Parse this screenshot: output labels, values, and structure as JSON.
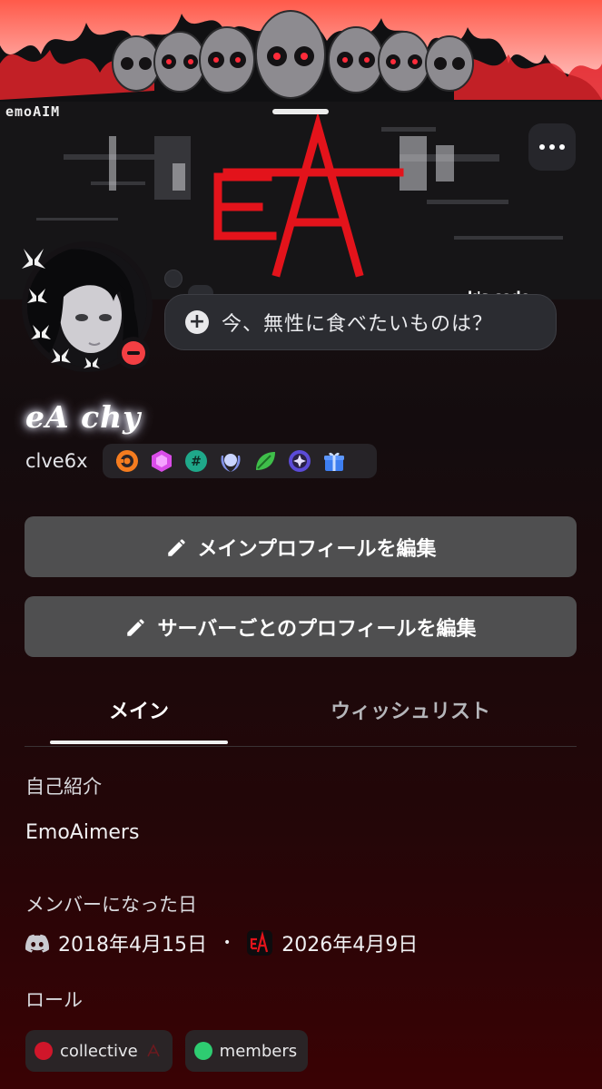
{
  "banner": {
    "top_label": "emoAIM",
    "ticker_text": "k's code",
    "logo_text": "eA"
  },
  "bubble": {
    "text": "今、無性に食べたいものは？"
  },
  "profile": {
    "display_name": "eA chy",
    "username": "clve6x"
  },
  "buttons": {
    "edit_main": "メインプロフィールを編集",
    "edit_server": "サーバーごとのプロフィールを編集"
  },
  "tabs": {
    "main": "メイン",
    "wishlist": "ウィッシュリスト"
  },
  "about": {
    "heading": "自己紹介",
    "text": "EmoAimers"
  },
  "member_since": {
    "heading": "メンバーになった日",
    "discord_date": "2018年4月15日",
    "separator": "•",
    "server_date": "2026年4月9日"
  },
  "roles": {
    "heading": "ロール",
    "items": [
      {
        "label": "collective",
        "color": "#d0162a"
      },
      {
        "label": "members",
        "color": "#2ecc71"
      }
    ]
  },
  "colors": {
    "status_dnd": "#f23f43",
    "accent_red": "#e3131b"
  },
  "badge_icons": [
    "hypesquad-badge-icon",
    "nitro-gem-icon",
    "hashtag-badge-icon",
    "laurel-badge-icon",
    "leaf-badge-icon",
    "quest-badge-icon",
    "gift-badge-icon"
  ]
}
